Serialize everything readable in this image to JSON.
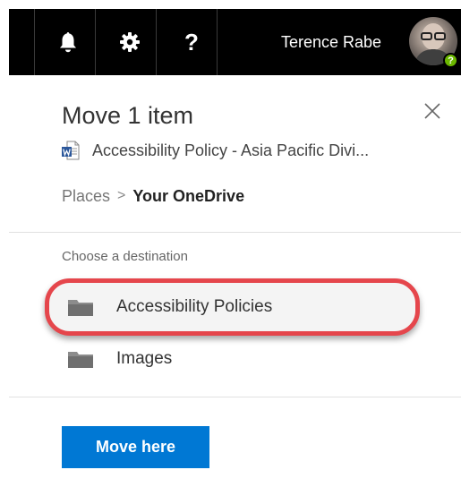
{
  "topbar": {
    "icons": [
      "bell-icon",
      "gear-icon",
      "help-icon"
    ],
    "help_glyph": "?",
    "user_name": "Terence Rabe",
    "presence_glyph": "?",
    "background": "#000000"
  },
  "panel": {
    "title": "Move 1 item",
    "file_name": "Accessibility Policy - Asia Pacific Divi...",
    "file_icon": "word-document-icon",
    "breadcrumb": {
      "root": "Places",
      "separator": ">",
      "current": "Your OneDrive"
    },
    "destination_prompt": "Choose a destination",
    "folders": [
      {
        "label": "Accessibility Policies",
        "icon": "folder-icon",
        "highlighted": true
      },
      {
        "label": "Images",
        "icon": "folder-icon",
        "highlighted": false
      }
    ],
    "move_button_label": "Move here"
  },
  "colors": {
    "accent": "#0078d4",
    "highlight_ring": "#e5464c",
    "presence": "#6bb700"
  }
}
